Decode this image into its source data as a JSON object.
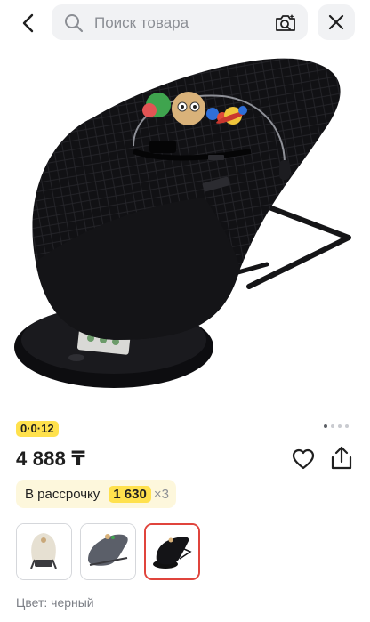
{
  "header": {
    "search_placeholder": "Поиск товара",
    "back_icon": "chevron-left-icon",
    "search_icon": "search-icon",
    "camera_icon": "camera-search-icon",
    "close_icon": "close-icon"
  },
  "gallery": {
    "image_alt": "Черный шезлонг-качалка с игрушкой",
    "dots_count": 4,
    "active_dot": 0
  },
  "product": {
    "installment_badge": "0·0·12",
    "price": "4 888 ₸",
    "favorite_icon": "heart-icon",
    "share_icon": "share-icon"
  },
  "installment": {
    "label": "В рассрочку",
    "amount": "1 630",
    "multiplier": "×3"
  },
  "variants": {
    "items": [
      {
        "name": "beige"
      },
      {
        "name": "gray"
      },
      {
        "name": "black",
        "selected": true
      }
    ]
  },
  "color": {
    "label": "Цвет: черный"
  },
  "colors": {
    "accent_yellow": "#ffe14d",
    "selected_border": "#e0443c",
    "search_bg": "#f1f2f4"
  }
}
